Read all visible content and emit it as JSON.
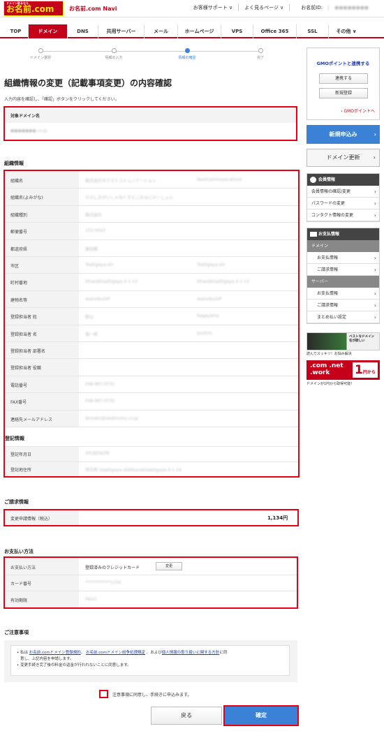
{
  "header": {
    "logo": "お名前.com",
    "logo_small": "ドメイン取るなら",
    "navi": "お名前.com Navi",
    "support": "お客様サポート ∨",
    "faq": "よく見るページ ∨",
    "id_label": "お名前ID:",
    "id_value": "●●●●●●●●"
  },
  "gnav": [
    "TOP",
    "ドメイン",
    "DNS",
    "共用サーバー",
    "メール",
    "ホームページ",
    "VPS",
    "Office 365",
    "SSL",
    "その他 ∨"
  ],
  "steps": [
    "ドメイン選択",
    "情報の入力",
    "情報の確認",
    "完了"
  ],
  "title": "組織情報の変更（記載事項変更）の内容確認",
  "subtitle": "入力内容を確認し、「確認」ボタンをクリックしてください。",
  "target": {
    "label": "対象ドメイン名",
    "value": "●●●●●●●.co.jp"
  },
  "org": {
    "heading": "組織情報",
    "rows": [
      {
        "label": "組織名",
        "v1": "株式会社ネクストコミュニケーション",
        "v2": "NextCommunications"
      },
      {
        "label": "組織名(よみがな)",
        "v1": "かぶしきがいしゃねくすとこみゅにけーしょん",
        "v2": ""
      },
      {
        "label": "組織種別",
        "v1": "株式会社",
        "v2": ""
      },
      {
        "label": "郵便番号",
        "v1": "153-0043",
        "v2": ""
      },
      {
        "label": "都道府県",
        "v1": "東京都",
        "v2": ""
      },
      {
        "label": "市区",
        "v1": "Toshigaya-shi",
        "v2": "Toshigaya-shi"
      },
      {
        "label": "町村番地",
        "v1": "Hiranishiashigaya 4-1-14",
        "v2": "Hiranishiashigaya 4-1-14"
      },
      {
        "label": "建物名等",
        "v1": "asanobu/UP",
        "v2": "asanobu/UP"
      },
      {
        "label": "登録担当者 姓",
        "v1": "新山",
        "v2": "Sagayama"
      },
      {
        "label": "登録担当者 名",
        "v1": "慎一郎",
        "v2": "yoshiro"
      },
      {
        "label": "登録担当者 部署名",
        "v1": "",
        "v2": ""
      },
      {
        "label": "登録担当者 役職",
        "v1": "",
        "v2": ""
      },
      {
        "label": "電話番号",
        "v1": "048-967-0731",
        "v2": ""
      },
      {
        "label": "FAX番号",
        "v1": "048-967-0732",
        "v2": ""
      },
      {
        "label": "連絡先メールアドレス",
        "v1": "domain@nexbcomu.co.jp",
        "v2": ""
      }
    ]
  },
  "reg": {
    "heading": "登記情報",
    "rows": [
      {
        "label": "登記年月日",
        "v1": "2018/04/09"
      },
      {
        "label": "登記地住所",
        "v1": "埼玉県 hiashigaya shiHiranishiashigaya 4-1-14"
      }
    ]
  },
  "billing": {
    "heading": "ご請求情報",
    "label": "変更申請情報（税込）",
    "amount": "1,134円"
  },
  "payment": {
    "heading": "お支払い方法",
    "rows": [
      {
        "label": "お支払い方法",
        "value": "登録済みのクレジットカード"
      },
      {
        "label": "カード番号",
        "value": "************1234"
      },
      {
        "label": "有効期限",
        "value": "06/21"
      }
    ],
    "change_btn": "変更"
  },
  "notes": {
    "heading": "ご注意事項",
    "l1a": "私は",
    "link1": "お名前.comドメイン登録規約",
    "l1b": "、",
    "link2": "お名前.comドメイン紛争処理規定",
    "l1c": "、および",
    "link3": "個人情報の取り扱いに関する方針",
    "l1d": "に同",
    "l1e": "意し、上記内容を申請します。",
    "l2": "変更手続き完了後の料金の返金が行われないことに同意します。"
  },
  "agree": "注意事項に同意し、手続きに申込みます。",
  "back": "戻る",
  "confirm": "確定",
  "side": {
    "gmo_title": "GMOポイントと連携する",
    "gmo_btn1": "連携する",
    "gmo_btn2": "新規登録",
    "gmo_link": "GMOポイントへ",
    "new_btn": "新規申込み",
    "renew_btn": "ドメイン更新",
    "member_head": "会員情報",
    "member_items": [
      "会員情報の確認/変更",
      "パスワードの変更",
      "コンタクト情報の変更"
    ],
    "pay_head": "お支払情報",
    "pay_g1": "ドメイン",
    "pay_items1": [
      "お支払情報",
      "ご請求情報"
    ],
    "pay_g2": "サーバー",
    "pay_items2": [
      "お支払情報",
      "ご請求情報",
      "まとめ払い設定"
    ],
    "banner1_text": "ベストなドメイン名が欲しい",
    "banner1_cap": "読んでスッキリ！お悩み解決",
    "banner2_text": ".com .net .work",
    "banner2_price": "1",
    "banner2_unit": "円から",
    "banner2_cap": "ドメインが1円から取得可能！"
  },
  "colors": {
    "brand": "#c4001a",
    "accent": "#3b82d6",
    "highlight": "#e60012"
  }
}
